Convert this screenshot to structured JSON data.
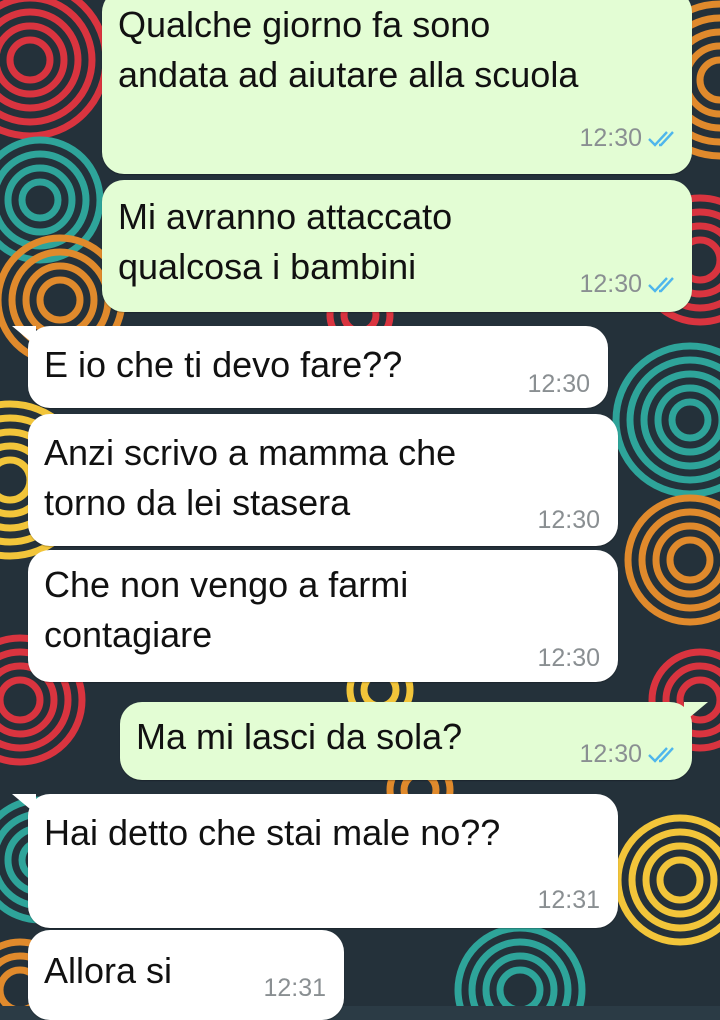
{
  "colors": {
    "outgoing_bubble": "#e3fdd4",
    "incoming_bubble": "#ffffff",
    "read_ticks": "#4fb6ec",
    "timestamp": "#8a8f92"
  },
  "messages": [
    {
      "direction": "outgoing",
      "text": "Qualche giorno fa sono\nandata ad aiutare alla scuola",
      "time": "12:30",
      "status": "read"
    },
    {
      "direction": "outgoing",
      "text": "Mi avranno attaccato\nqualcosa i bambini",
      "time": "12:30",
      "status": "read"
    },
    {
      "direction": "incoming",
      "text": "E io che ti devo fare??",
      "time": "12:30"
    },
    {
      "direction": "incoming",
      "text": "Anzi scrivo a mamma che\ntorno da lei stasera",
      "time": "12:30"
    },
    {
      "direction": "incoming",
      "text": "Che non vengo a farmi\ncontagiare",
      "time": "12:30"
    },
    {
      "direction": "outgoing",
      "text": "Ma mi lasci da sola?",
      "time": "12:30",
      "status": "read"
    },
    {
      "direction": "incoming",
      "text": "Hai detto che stai male no??",
      "time": "12:31"
    },
    {
      "direction": "incoming",
      "text": "Allora si",
      "time": "12:31"
    }
  ],
  "icons": {
    "read_receipt": "double-check-icon"
  }
}
